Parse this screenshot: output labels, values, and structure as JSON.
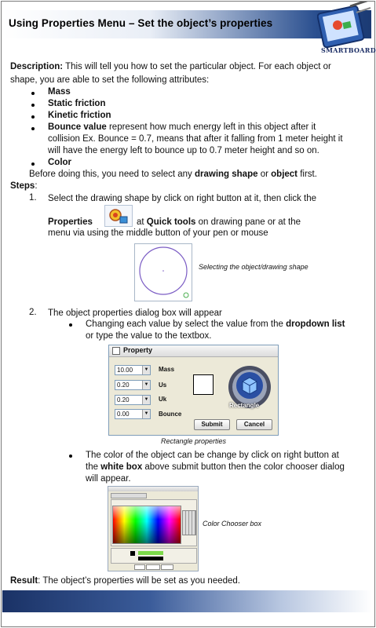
{
  "header": {
    "title": "Using Properties Menu – Set the object’s properties",
    "logo_text": "SMARTBOARD"
  },
  "description": {
    "label": "Description:",
    "line1": " This will tell you how to set the particular object. For each object or",
    "line2": "shape, you are able to set the following attributes:",
    "attributes": [
      "Mass",
      "Static friction",
      "Kinetic friction",
      "Bounce value",
      "Color"
    ],
    "bounce_desc": [
      " represent how much energy left in this object after it",
      "collision Ex. Bounce = 0.7, means that after it falling from 1 meter height it",
      "will have the energy left to bounce up to 0.7 meter height and so on."
    ],
    "note_pre": "Before doing this, you need to select any ",
    "note_b1": "drawing shape",
    "note_mid": " or ",
    "note_b2": "object",
    "note_post": " first."
  },
  "steps": {
    "label": "Steps",
    "colon": ":",
    "step1": {
      "num": "1.",
      "line1": "Select the drawing shape by click on right button at it, then click the",
      "properties": "Properties",
      "at": "at ",
      "quick_tools": "Quick tools",
      "rest": " on drawing pane or at the",
      "line3": "menu via using the middle button of your pen or mouse",
      "caption": "Selecting the object/drawing shape"
    },
    "step2": {
      "num": "2.",
      "line1": "The object properties dialog box will appear",
      "sub1_pre": "Changing each value by select the value from the ",
      "sub1_b": "dropdown list",
      "sub1_line2": "or type the value to the textbox.",
      "caption_dialog": "Rectangle properties",
      "sub2_line1": "The color of the object can be change by click on right button at",
      "sub2_pre": "the ",
      "sub2_b": "white box",
      "sub2_post": " above submit button then the color chooser dialog",
      "sub2_line3": "will appear.",
      "caption_cc": "Color Chooser box"
    }
  },
  "dialog": {
    "title": "Property",
    "fields": [
      {
        "value": "10.00",
        "label": "Mass"
      },
      {
        "value": "0.20",
        "label": "Us"
      },
      {
        "value": "0.20",
        "label": "Uk"
      },
      {
        "value": "0.00",
        "label": "Bounce"
      }
    ],
    "badge_text": "Rectangle",
    "submit": "Submit",
    "cancel": "Cancel"
  },
  "result": {
    "label": "Result",
    "text": ": The object’s properties will be set as you needed."
  },
  "colors": {
    "header_dark": "#1b3a73",
    "footer_dark": "#1a3266",
    "circle": "#7b5cc4"
  }
}
